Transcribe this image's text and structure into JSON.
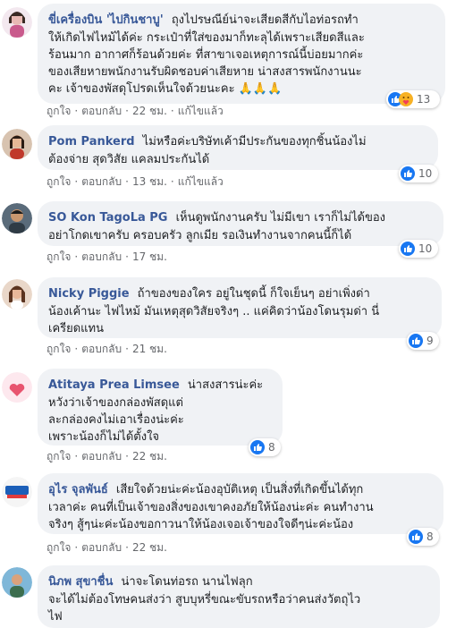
{
  "comments": [
    {
      "author": "ขี่เครื่องบิน 'ไปกินชาบู'",
      "text_lines": [
        "ถุงไปรษณีย์น่าจะเสียดสีกับไอท่อรถทำ",
        "ให้เกิดไฟไหม้ได้ค่ะ กระเป๋าที่ใส่ของมาก็ทะลุได้เพราะเสียดสีและ",
        "ร้อนมาก อากาศก็ร้อนด้วยค่ะ ที่สาขาเจอเหตุการณ์นี้บ่อยมากค่ะ",
        "ของเสียหายพนักงานรับผิดชอบค่าเสียหาย น่าสงสารพนักงานนะ",
        "คะ เจ้าของพัสดุโปรดเห็นใจด้วยนะคะ 🙏🙏🙏"
      ],
      "reactions": {
        "types": [
          "like",
          "care"
        ],
        "count": "13"
      },
      "actions": {
        "like": "ถูกใจ",
        "reply": "ตอบกลับ",
        "time": "22 ชม.",
        "extra": "แก้ไขแล้ว"
      }
    },
    {
      "author": "Pom Pankerd",
      "text_lines": [
        "ไม่หรือค่ะบริษัทเค้ามีประกันของทุกชิ้นน้องไม่",
        "ต้องจ่าย สุดวิสัย แคลมประกันได้"
      ],
      "reactions": {
        "types": [
          "like"
        ],
        "count": "10"
      },
      "actions": {
        "like": "ถูกใจ",
        "reply": "ตอบกลับ",
        "time": "13 ชม.",
        "extra": "แก้ไขแล้ว"
      }
    },
    {
      "author": "SO Kon TagoLa PG",
      "text_lines": [
        "เห็นดูพนักงานครับ ไม่มีเขา เราก็ไม่ได้ของ",
        "อย่าโกดเขาครับ ครอบครัว ลูกเมีย รอเงินทำงานจากคนนี้ก็ได้"
      ],
      "reactions": {
        "types": [
          "like"
        ],
        "count": "10"
      },
      "actions": {
        "like": "ถูกใจ",
        "reply": "ตอบกลับ",
        "time": "17 ชม.",
        "extra": ""
      }
    },
    {
      "author": "Nicky Piggie",
      "text_lines": [
        "ถ้าของของใคร อยู่ในชุดนี้ ก็ใจเย็นๆ อย่าเพิ่งด่า",
        "น้องเค้านะ ไฟไหม้ มันเหตุสุดวิสัยจริงๆ .. แค่คิดว่าน้องโดนรุมด่า นี่",
        "เครียดแทน"
      ],
      "reactions": {
        "types": [
          "like"
        ],
        "count": "9"
      },
      "actions": {
        "like": "ถูกใจ",
        "reply": "ตอบกลับ",
        "time": "21 ชม.",
        "extra": ""
      }
    },
    {
      "author": "Atitaya Prea Limsee",
      "text_lines": [
        "น่าสงสารน่ะค่ะ",
        "หวังว่าเจ้าของกล่องพัสดุแต่",
        "ละกล่องคงไม่เอาเรื่องน่ะค่ะ",
        "เพราะน้องก็ไม่ได้ตั้งใจ"
      ],
      "reactions": {
        "types": [
          "like"
        ],
        "count": "8"
      },
      "actions": {
        "like": "ถูกใจ",
        "reply": "ตอบกลับ",
        "time": "22 ชม.",
        "extra": ""
      }
    },
    {
      "author": "อุไร จุลพันธ์",
      "text_lines": [
        "เสียใจด้วยน่ะค่ะน้องอุบัติเหตุ เป็นสิ่งที่เกิดขึ้นได้ทุก",
        "เวลาค่ะ คนที่เป็นเจ้าของสิ่งของเขาคงอภัยให้น้องน่ะค่ะ คนทำงาน",
        "จริงๆ สู้ๆน่ะค่ะน้องขอกาวนาให้น้องเจอเจ้าของใจดีๆน่ะค่ะน้อง"
      ],
      "reactions": {
        "types": [
          "like"
        ],
        "count": "8"
      },
      "actions": {
        "like": "ถูกใจ",
        "reply": "ตอบกลับ",
        "time": "22 ชม.",
        "extra": ""
      }
    },
    {
      "author": "นิภพ สุขาชื่น",
      "text_lines": [
        "น่าจะโดนท่อรถ นานไฟลุก",
        "จะได้ไม่ต้องโทษคนส่งว่า สูบบุหรี่ขณะขับรถหรือว่าคนส่งวัตถุไว",
        "ไฟ"
      ],
      "reactions": {
        "types": [],
        "count": ""
      },
      "actions": {
        "like": "",
        "reply": "",
        "time": "",
        "extra": ""
      }
    }
  ],
  "colors": {
    "like": "#1877f2",
    "care_face": "#f7b125",
    "care_heart": "#f33e58",
    "author": "#385898"
  }
}
